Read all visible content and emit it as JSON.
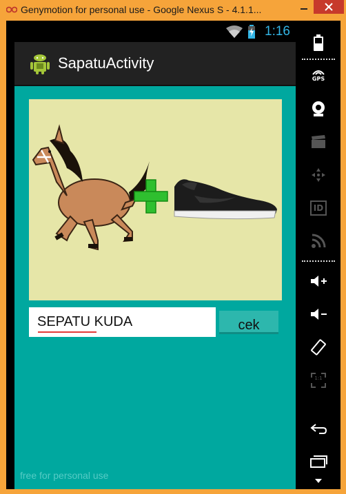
{
  "window": {
    "title": "Genymotion for personal use - Google Nexus S - 4.1.1..."
  },
  "statusbar": {
    "time": "1:16"
  },
  "actionbar": {
    "title": "SapatuActivity"
  },
  "answer": {
    "value": "SEPATU KUDA"
  },
  "check_button": {
    "label": "cek"
  },
  "watermark": {
    "text": "free for personal use"
  },
  "side_toolbar": {
    "gps_label": "GPS",
    "id_label": "ID",
    "ratio_label": "1:1"
  },
  "colors": {
    "accent": "#33b5e5",
    "content_bg": "#00a89f",
    "image_bg": "#e6e6a8",
    "window_frame": "#f6a43a"
  }
}
